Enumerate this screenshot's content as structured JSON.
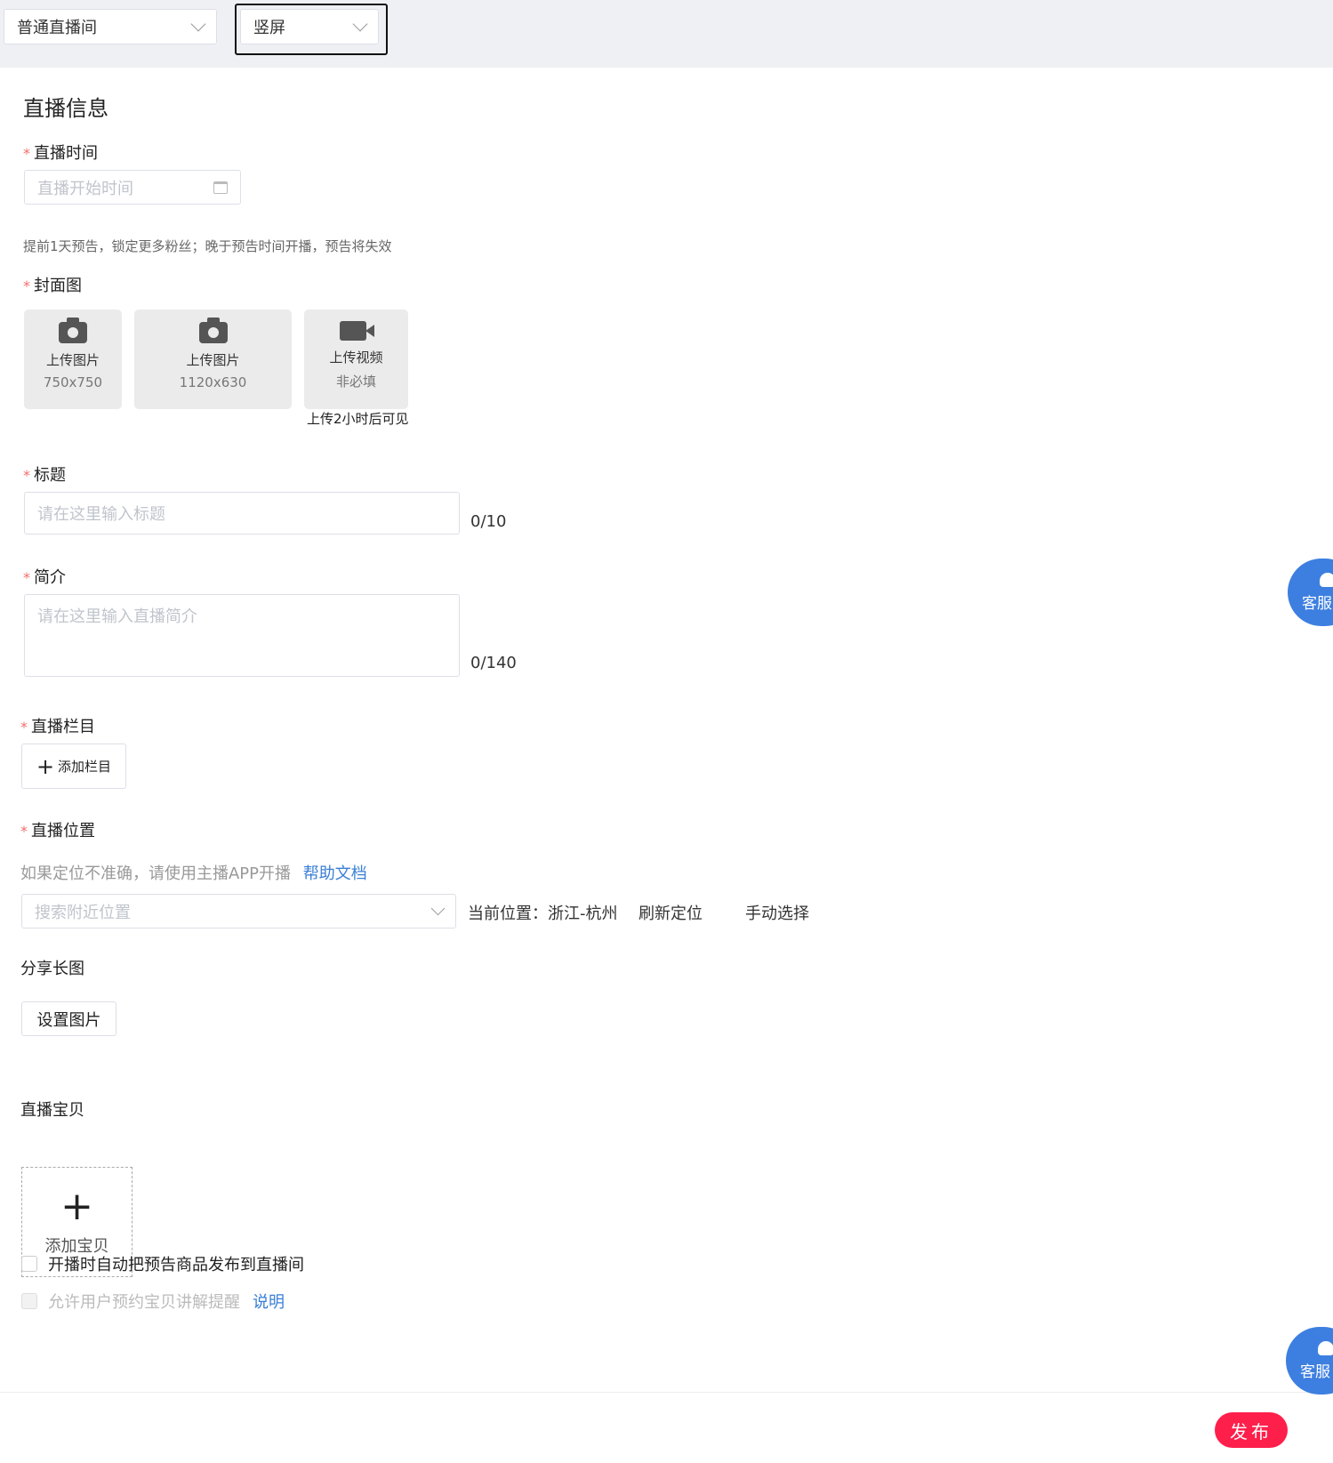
{
  "topbar": {
    "room_type": "普通直播间",
    "orientation": "竖屏"
  },
  "form": {
    "section_title": "直播信息",
    "required_mark": "*",
    "time": {
      "label": "直播时间",
      "placeholder": "直播开始时间",
      "hint": "提前1天预告，锁定更多粉丝；晚于预告时间开播，预告将失效"
    },
    "cover": {
      "label": "封面图",
      "uploads": [
        {
          "title": "上传图片",
          "sub": "750x750"
        },
        {
          "title": "上传图片",
          "sub": "1120x630"
        },
        {
          "title": "上传视频",
          "sub": "非必填"
        }
      ],
      "video_note": "上传2小时后可见"
    },
    "title": {
      "label": "标题",
      "placeholder": "请在这里输入标题",
      "counter": "0/10"
    },
    "intro": {
      "label": "简介",
      "placeholder": "请在这里输入直播简介",
      "counter": "0/140"
    },
    "column": {
      "label": "直播栏目",
      "add_button": "添加栏目"
    },
    "location": {
      "label": "直播位置",
      "hint": "如果定位不准确，请使用主播APP开播",
      "help_link": "帮助文档",
      "search_placeholder": "搜索附近位置",
      "current": "当前位置：浙江-杭州",
      "refresh": "刷新定位",
      "manual": "手动选择"
    },
    "share": {
      "label": "分享长图",
      "button": "设置图片"
    },
    "goods": {
      "label": "直播宝贝",
      "add_label": "添加宝贝",
      "auto_publish": "开播时自动把预告商品发布到直播间",
      "allow_reserve": "允许用户预约宝贝讲解提醒",
      "explain_link": "说明"
    }
  },
  "actions": {
    "publish": "发布",
    "service": "客服"
  },
  "colors": {
    "accent_link": "#3a7fd5",
    "publish_bg": "#ff1f4b",
    "service_bg": "#3d7fe0",
    "required": "#f56c6c"
  }
}
